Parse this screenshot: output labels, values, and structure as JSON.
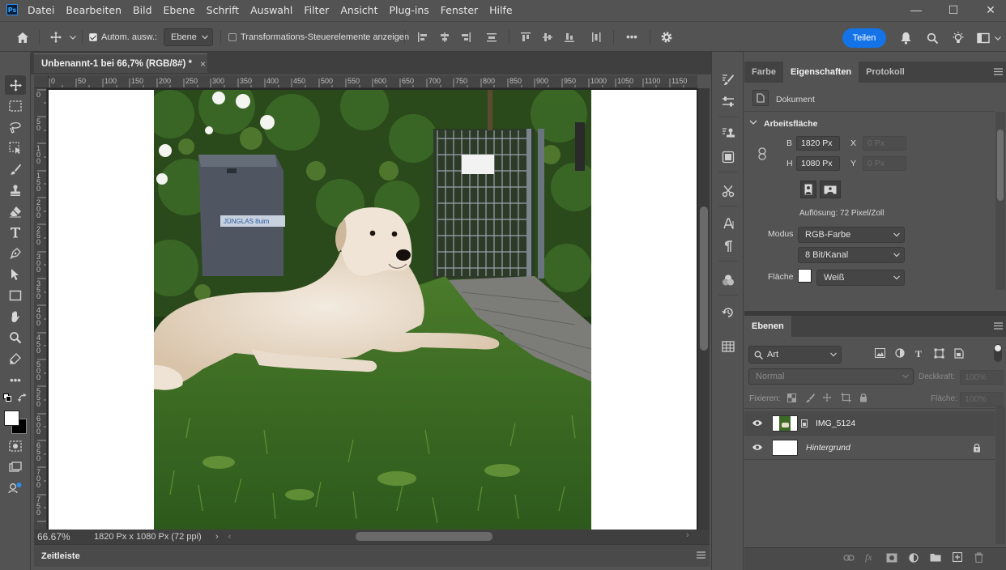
{
  "app": {
    "logo": "Ps"
  },
  "menubar": {
    "items": [
      "Datei",
      "Bearbeiten",
      "Bild",
      "Ebene",
      "Schrift",
      "Auswahl",
      "Filter",
      "Ansicht",
      "Plug-ins",
      "Fenster",
      "Hilfe"
    ]
  },
  "window_controls": {
    "minimize": "—",
    "maximize": "☐",
    "close": "✕"
  },
  "options_bar": {
    "auto_select_label": "Autom. ausw.:",
    "auto_select_checked": true,
    "auto_select_target": "Ebene",
    "transform_controls_label": "Transformations-Steuerelemente anzeigen",
    "transform_controls_checked": false,
    "more_label": "•••",
    "share_label": "Teilen"
  },
  "collapse_glyph": "»",
  "document": {
    "tab_title": "Unbenannt-1 bei 66,7% (RGB/8#) *",
    "tab_close": "×",
    "zoom": "66.67%",
    "info": "1820 Px x 1080 Px (72 ppi)",
    "ruler_h": [
      "0",
      "50",
      "100",
      "150",
      "200",
      "250",
      "300",
      "350",
      "400",
      "450",
      "500",
      "550",
      "600",
      "650",
      "700",
      "750",
      "800",
      "850",
      "900",
      "950",
      "1000",
      "1050",
      "1100",
      "1150"
    ],
    "ruler_v": [
      "0",
      "50",
      "100",
      "150",
      "200",
      "250",
      "300",
      "350",
      "400",
      "450",
      "500",
      "550",
      "600",
      "650",
      "700",
      "750",
      "800"
    ],
    "photo_sign_text": "JÜNGLAS 8uim"
  },
  "timeline": {
    "label": "Zeitleiste"
  },
  "properties": {
    "tabs": [
      "Farbe",
      "Eigenschaften",
      "Protokoll"
    ],
    "active_tab": "Eigenschaften",
    "document_label": "Dokument",
    "section": "Arbeitsfläche",
    "width_label": "B",
    "width_value": "1820 Px",
    "height_label": "H",
    "height_value": "1080 Px",
    "x_label": "X",
    "x_value": "0 Px",
    "y_label": "Y",
    "y_value": "0 Px",
    "resolution": "Auflösung: 72 Pixel/Zoll",
    "mode_label": "Modus",
    "mode_value": "RGB-Farbe",
    "depth_value": "8 Bit/Kanal",
    "fill_label": "Fläche",
    "fill_value": "Weiß",
    "fill_color": "#ffffff"
  },
  "layers": {
    "tab": "Ebenen",
    "filter_kind": "Art",
    "blend_mode": "Normal",
    "opacity_label": "Deckkraft:",
    "opacity_value": "100%",
    "lock_label": "Fixieren:",
    "fill_label": "Fläche:",
    "fill_value": "100%",
    "items": [
      {
        "name": "IMG_5124",
        "visible": true,
        "locked": false,
        "selected": true
      },
      {
        "name": "Hintergrund",
        "visible": true,
        "locked": true,
        "selected": false
      }
    ]
  },
  "colors": {
    "accent": "#1473e6",
    "panel": "#535353",
    "panel_dark": "#424242",
    "canvas": "#282828"
  }
}
